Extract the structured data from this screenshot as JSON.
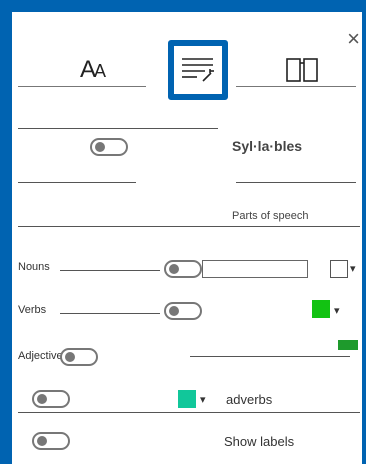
{
  "window": {
    "close_glyph": "×"
  },
  "tabs": [
    {
      "name": "text-size",
      "glyph_big": "A",
      "glyph_small": "A"
    },
    {
      "name": "grammar-tools",
      "selected": true
    },
    {
      "name": "reading-preferences"
    }
  ],
  "syllables": {
    "label": "Syl·la·bles"
  },
  "parts_of_speech": {
    "header": "Parts of speech",
    "rows": [
      {
        "label": "Nouns",
        "color": "#ffffff"
      },
      {
        "label": "Verbs",
        "color": "#12c212"
      },
      {
        "label": "Adjectives",
        "color": "#1e9a2c"
      },
      {
        "label": "adverbs",
        "color": "#11c79a"
      }
    ],
    "show_labels": "Show labels"
  },
  "accent_color": "#0063b1"
}
